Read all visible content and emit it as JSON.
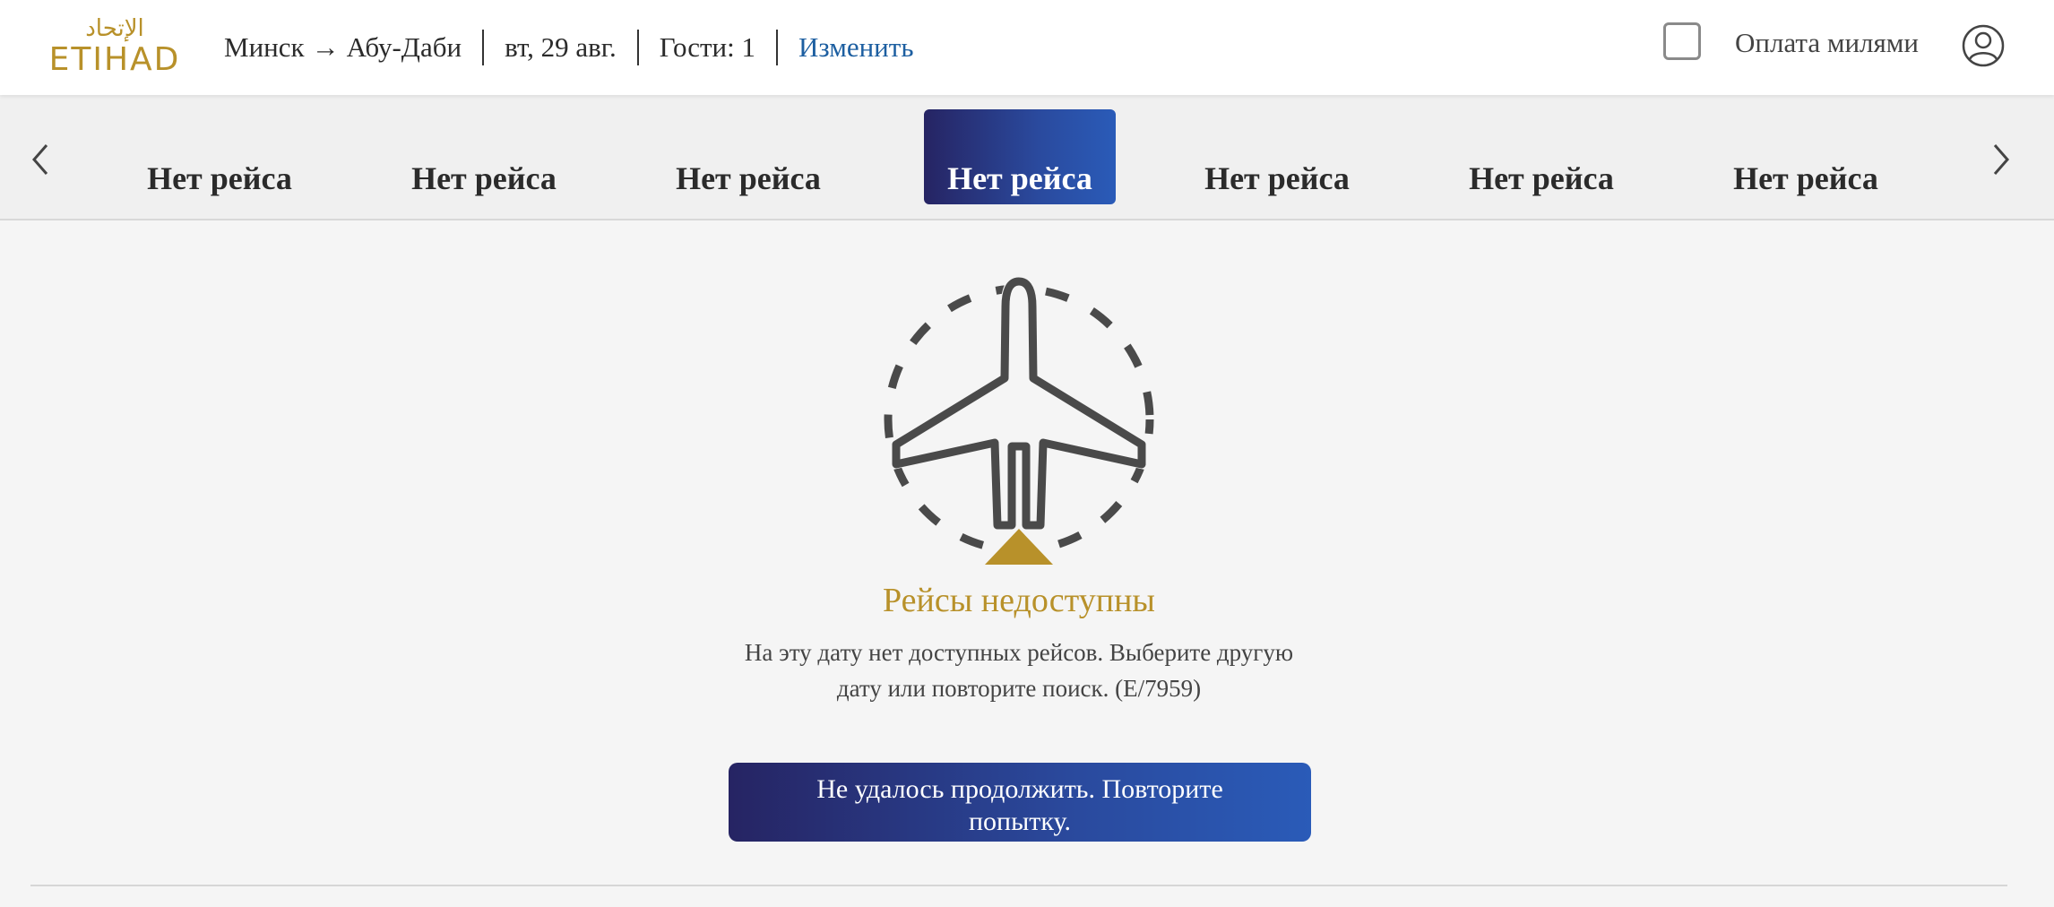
{
  "brand": {
    "logo_arabic": "الإتحاد",
    "logo_latin": "ETIHAD",
    "gold_color": "#b8912a"
  },
  "header": {
    "route_from": "Минск",
    "route_arrow": "→",
    "route_to": "Абу-Даби",
    "date": "вт, 29 авг.",
    "guests": "Гости: 1",
    "change_link": "Изменить",
    "pay_with_miles_label": "Оплата милями",
    "pay_with_miles_checked": false
  },
  "date_strip": {
    "prev_icon": "chevron-left-icon",
    "next_icon": "chevron-right-icon",
    "selected_index": 3,
    "items": [
      {
        "label": "Нет рейса"
      },
      {
        "label": "Нет рейса"
      },
      {
        "label": "Нет рейса"
      },
      {
        "label": "Нет рейса"
      },
      {
        "label": "Нет рейса"
      },
      {
        "label": "Нет рейса"
      },
      {
        "label": "Нет рейса"
      }
    ]
  },
  "main": {
    "illustration_icon": "plane-circle-icon",
    "title": "Рейсы недоступны",
    "message": "На эту дату нет доступных рейсов. Выберите другую дату или повторите поиск. (E/7959)",
    "retry_button": "Не удалось продолжить. Повторите попытку."
  },
  "colors": {
    "accent_blue_dark": "#262463",
    "accent_blue_light": "#2a5bb8",
    "link_blue": "#1d5fa1",
    "illustration_gray": "#4a4a4a"
  }
}
